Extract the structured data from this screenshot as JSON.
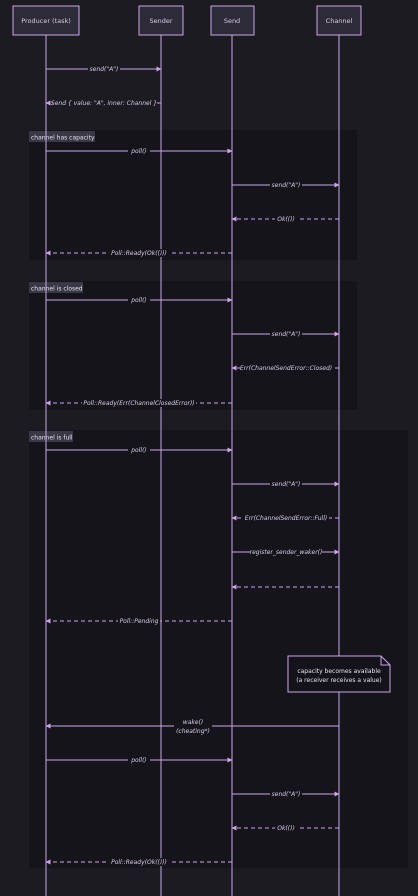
{
  "actors": [
    {
      "name": "Producer (task)"
    },
    {
      "name": "Sender"
    },
    {
      "name": "Send"
    },
    {
      "name": "Channel"
    }
  ],
  "sections": [
    {
      "label": "channel has capacity"
    },
    {
      "label": "channel is closed"
    },
    {
      "label": "channel is full"
    }
  ],
  "messages": [
    {
      "text": "send(\"A\")"
    },
    {
      "text": "Send { value: \"A\", inner: Channel }"
    },
    {
      "text": "poll()"
    },
    {
      "text": "send(\"A\")"
    },
    {
      "text": "Ok(())"
    },
    {
      "text": "Poll::Ready(Ok(()))"
    },
    {
      "text": "poll()"
    },
    {
      "text": "send(\"A\")"
    },
    {
      "text": "Err(ChannelSendError::Closed)"
    },
    {
      "text": "Poll::Ready(Err(ChannelClosedError))"
    },
    {
      "text": "poll()"
    },
    {
      "text": "send(\"A\")"
    },
    {
      "text": "Err(ChannelSendError::Full)"
    },
    {
      "text": "register_sender_waker()"
    },
    {
      "text": ""
    },
    {
      "text": "Poll::Pending"
    },
    {
      "text": "wake()",
      "text2": "(cheating*)"
    },
    {
      "text": "poll()"
    },
    {
      "text": "send(\"A\")"
    },
    {
      "text": "Ok(())"
    },
    {
      "text": "Poll::Ready(Ok(()))"
    }
  ],
  "note": {
    "line1": "capacity becomes available",
    "line2": "(a receiver receives a value)"
  },
  "colors": {
    "background": "#1c1b22",
    "section_fill": "#15141b",
    "lifeline": "#c9a6e8",
    "actor_fill": "#2e2b38",
    "arrow": "#c9a6e8",
    "note_fill": "#14131a"
  }
}
